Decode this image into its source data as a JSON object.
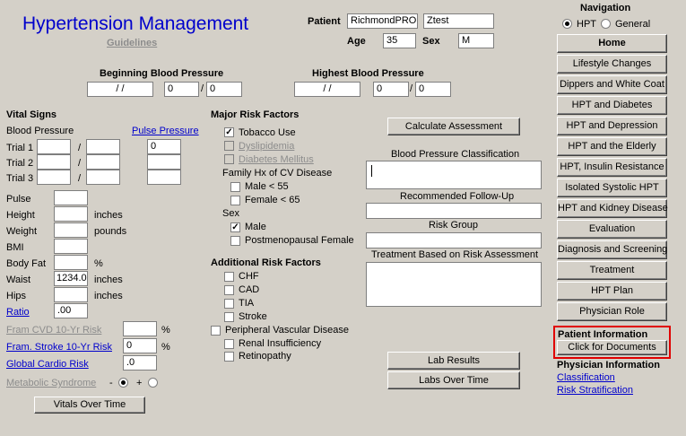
{
  "header": {
    "title": "Hypertension Management",
    "guidelines": "Guidelines",
    "patient_label": "Patient",
    "patient_last": "RichmondPROD",
    "patient_first": "Ztest",
    "age_label": "Age",
    "age": "35",
    "sex_label": "Sex",
    "sex": "M"
  },
  "navigation": {
    "title": "Navigation",
    "opt_hpt": "HPT",
    "opt_general": "General",
    "selected": "HPT",
    "items": [
      "Home",
      "Lifestyle Changes",
      "Dippers and White Coat",
      "HPT and Diabetes",
      "HPT and Depression",
      "HPT and the Elderly",
      "HPT,  Insulin Resistance",
      "Isolated Systolic HPT",
      "HPT and Kidney Disease",
      "Evaluation",
      "Diagnosis and Screening",
      "Treatment",
      "HPT Plan",
      "Physician Role"
    ]
  },
  "patient_info": {
    "title": "Patient Information",
    "button": "Click for Documents"
  },
  "physician_info": {
    "title": "Physician Information",
    "classification": "Classification",
    "risk_stratification": "Risk Stratification"
  },
  "bp": {
    "beginning_label": "Beginning Blood Pressure",
    "beginning_date": " / /",
    "beginning_sys": "0",
    "beginning_dia": "0",
    "highest_label": "Highest Blood Pressure",
    "highest_date": " / /",
    "highest_sys": "0",
    "highest_dia": "0",
    "sep": "/"
  },
  "vitals": {
    "title": "Vital Signs",
    "bp_label": "Blood Pressure",
    "pulse_pressure": "Pulse Pressure",
    "trial1": "Trial 1",
    "trial2": "Trial 2",
    "trial3": "Trial 3",
    "trial1_pp": "0",
    "pulse": "Pulse",
    "height": "Height",
    "weight": "Weight",
    "bmi": "BMI",
    "body_fat": "Body Fat",
    "waist": "Waist",
    "waist_value": "1234.0",
    "hips": "Hips",
    "ratio": "Ratio",
    "ratio_value": ".00",
    "inches": "inches",
    "pounds": "pounds",
    "percent": "%",
    "fram_cvd": "Fram CVD 10-Yr Risk",
    "fram_stroke": "Fram. Stroke 10-Yr Risk",
    "fram_stroke_value": "0",
    "global_cardio": "Global Cardio Risk",
    "global_cardio_value": ".0",
    "metabolic": "Metabolic Syndrome",
    "minus": "-",
    "plus": "+",
    "vitals_over_time": "Vitals Over Time"
  },
  "risk": {
    "title": "Major Risk Factors",
    "tobacco": "Tobacco Use",
    "dyslipidemia": "Dyslipidemia",
    "diabetes": "Diabetes Mellitus",
    "family_hx": "Family Hx of CV Disease",
    "male55": "Male < 55",
    "female65": "Female < 65",
    "sex": "Sex",
    "male": "Male",
    "postmeno": "Postmenopausal Female",
    "additional_title": "Additional Risk Factors",
    "chf": "CHF",
    "cad": "CAD",
    "tia": "TIA",
    "stroke": "Stroke",
    "pvd": "Peripheral Vascular Disease",
    "renal": "Renal Insufficiency",
    "retino": "Retinopathy"
  },
  "assessment": {
    "calculate": "Calculate Assessment",
    "bp_class": "Blood Pressure Classification",
    "followup": "Recommended Follow-Up",
    "risk_group": "Risk Group",
    "treatment": "Treatment Based on Risk Assessment",
    "lab_results": "Lab Results",
    "labs_over_time": "Labs Over Time"
  },
  "colors": {
    "title_blue": "#0000cc",
    "highlight_red": "#e00000",
    "panel_bg": "#d4d0c8"
  }
}
